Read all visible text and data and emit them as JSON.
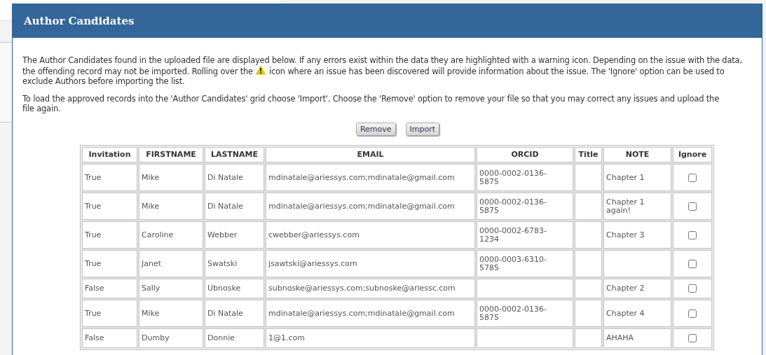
{
  "dialog": {
    "title": "Author Candidates"
  },
  "intro": {
    "before_icon": "The Author Candidates found in the uploaded file are displayed below. If any errors exist within the data they are highlighted with a warning icon. Depending on the issue with the data, the offending record may not be imported. Rolling over the",
    "after_icon": "icon where an issue has been discovered will provide information about the issue. The 'Ignore' option can be used to exclude Authors before importing the list."
  },
  "instructions": "To load the approved records into the 'Author Candidates' grid choose 'Import'. Choose the 'Remove' option to remove your file so that you may correct any issues and upload the file again.",
  "buttons": [
    "Remove",
    "Import"
  ],
  "table": {
    "columns": [
      "Invitation",
      "FIRSTNAME",
      "LASTNAME",
      "EMAIL",
      "ORCID",
      "Title",
      "NOTE",
      "Ignore"
    ],
    "rows": [
      {
        "invitation": "True",
        "firstname": "Mike",
        "lastname": "Di Natale",
        "email": "mdinatale@ariessys.com;mdinatale@gmail.com",
        "orcid": "0000-0002-0136-5875",
        "note": "Chapter 1",
        "ignore": false
      },
      {
        "invitation": "True",
        "firstname": "Mike",
        "lastname": "Di Natale",
        "email": "mdinatale@ariessys.com;mdinatale@gmail.com",
        "orcid": "0000-0002-0136-5875",
        "note": "Chapter 1 again!",
        "ignore": false
      },
      {
        "invitation": "True",
        "firstname": "Caroline",
        "lastname": "Webber",
        "email": "cwebber@ariessys.com",
        "orcid": "0000-0002-6783-1234",
        "note": "Chapter 3",
        "ignore": false
      },
      {
        "invitation": "True",
        "firstname": "Janet",
        "lastname": "Swatski",
        "email": "jsawtski@ariessys.com",
        "orcid": "0000-0003-6310-5785",
        "ignore": false
      },
      {
        "invitation": "False",
        "firstname": "Sally",
        "lastname": "Ubnoske",
        "email": "subnoske@ariessys.com;subnoske@ariessc.com",
        "note": "Chapter 2",
        "ignore": false
      },
      {
        "invitation": "True",
        "firstname": "Mike",
        "lastname": "Di Natale",
        "email": "mdinatale@ariessys.com;mdinatale@gmail.com",
        "orcid": "0000-0002-0136-5875",
        "note": "Chapter 4",
        "ignore": false
      },
      {
        "invitation": "False",
        "firstname": "Dumby",
        "lastname": "Donnie",
        "email": "1@1.com",
        "note": "AHAHA",
        "ignore": false
      }
    ]
  }
}
